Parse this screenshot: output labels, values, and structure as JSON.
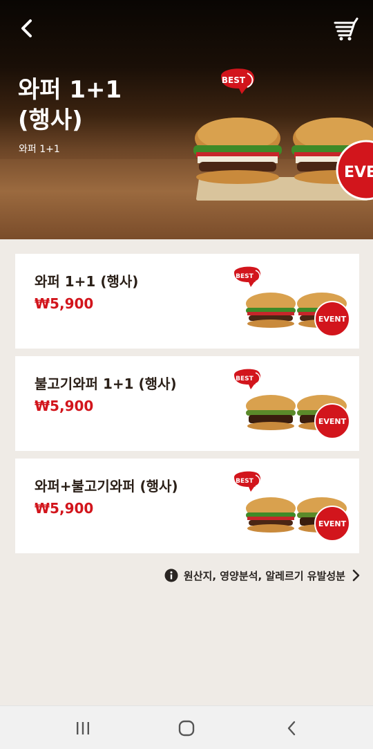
{
  "hero": {
    "title": "와퍼 1+1\n(행사)",
    "subtitle": "와퍼 1+1",
    "best_badge": "BEST",
    "event_badge": "EVEN"
  },
  "menu_items": [
    {
      "name": "와퍼 1+1 (행사)",
      "price": "₩5,900",
      "best": "BEST",
      "event": "EVENT"
    },
    {
      "name": "불고기와퍼 1+1 (행사)",
      "price": "₩5,900",
      "best": "BEST",
      "event": "EVENT"
    },
    {
      "name": "와퍼+불고기와퍼 (행사)",
      "price": "₩5,900",
      "best": "BEST",
      "event": "EVENT"
    }
  ],
  "info_link": {
    "label": "원산지, 영양분석, 알레르기 유발성분"
  },
  "colors": {
    "accent": "#d2151c",
    "background": "#efebe6",
    "card": "#ffffff"
  },
  "icons": [
    "back-arrow-icon",
    "cart-icon",
    "info-icon",
    "chevron-right-icon",
    "recent-apps-icon",
    "home-icon",
    "system-back-icon"
  ]
}
